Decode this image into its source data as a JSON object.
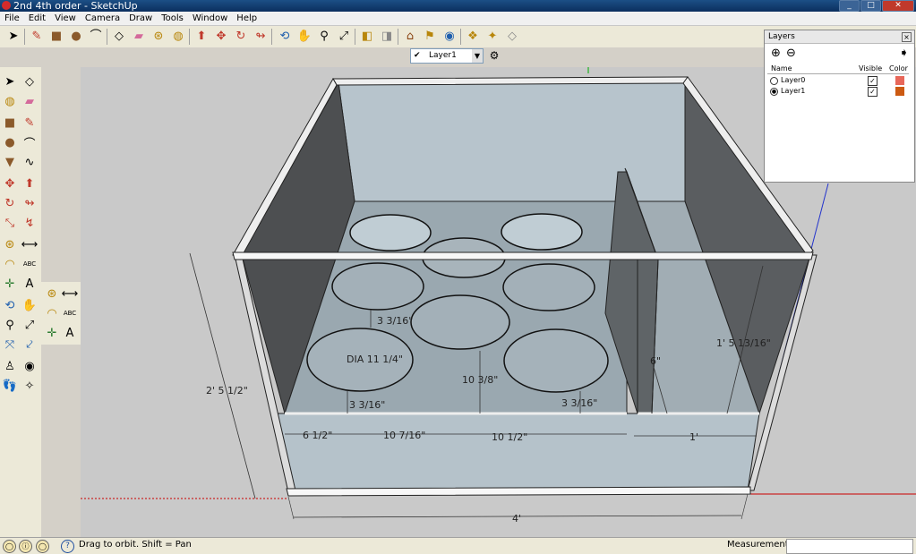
{
  "window": {
    "title": "2nd 4th order - SketchUp"
  },
  "menu": [
    "File",
    "Edit",
    "View",
    "Camera",
    "Draw",
    "Tools",
    "Window",
    "Help"
  ],
  "layer_dropdown": {
    "value": "Layer1",
    "check": "✔"
  },
  "layers_panel": {
    "title": "Layers",
    "columns": {
      "name": "Name",
      "visible": "Visible",
      "color": "Color"
    },
    "rows": [
      {
        "name": "Layer0",
        "active": false,
        "visible": true,
        "color": "#e8675a"
      },
      {
        "name": "Layer1",
        "active": true,
        "visible": true,
        "color": "#cc5a12"
      }
    ]
  },
  "dimensions": {
    "height_left": "2' 5 1/2\"",
    "width_bottom": "4'",
    "dia": "DIA 11 1/4\"",
    "gap_top": "3 3/16\"",
    "gap_bottom_left": "3 3/16\"",
    "gap_bottom_right": "3 3/16\"",
    "vertical_mid": "10 3/8\"",
    "seg1": "6 1/2\"",
    "seg2": "10 7/16\"",
    "seg3": "10 1/2\"",
    "right_width": "1'",
    "right_height": "1' 5 13/16\"",
    "port": "6\""
  },
  "status": {
    "message": "Drag to orbit.  Shift = Pan",
    "measurements_label": "Measurements"
  }
}
